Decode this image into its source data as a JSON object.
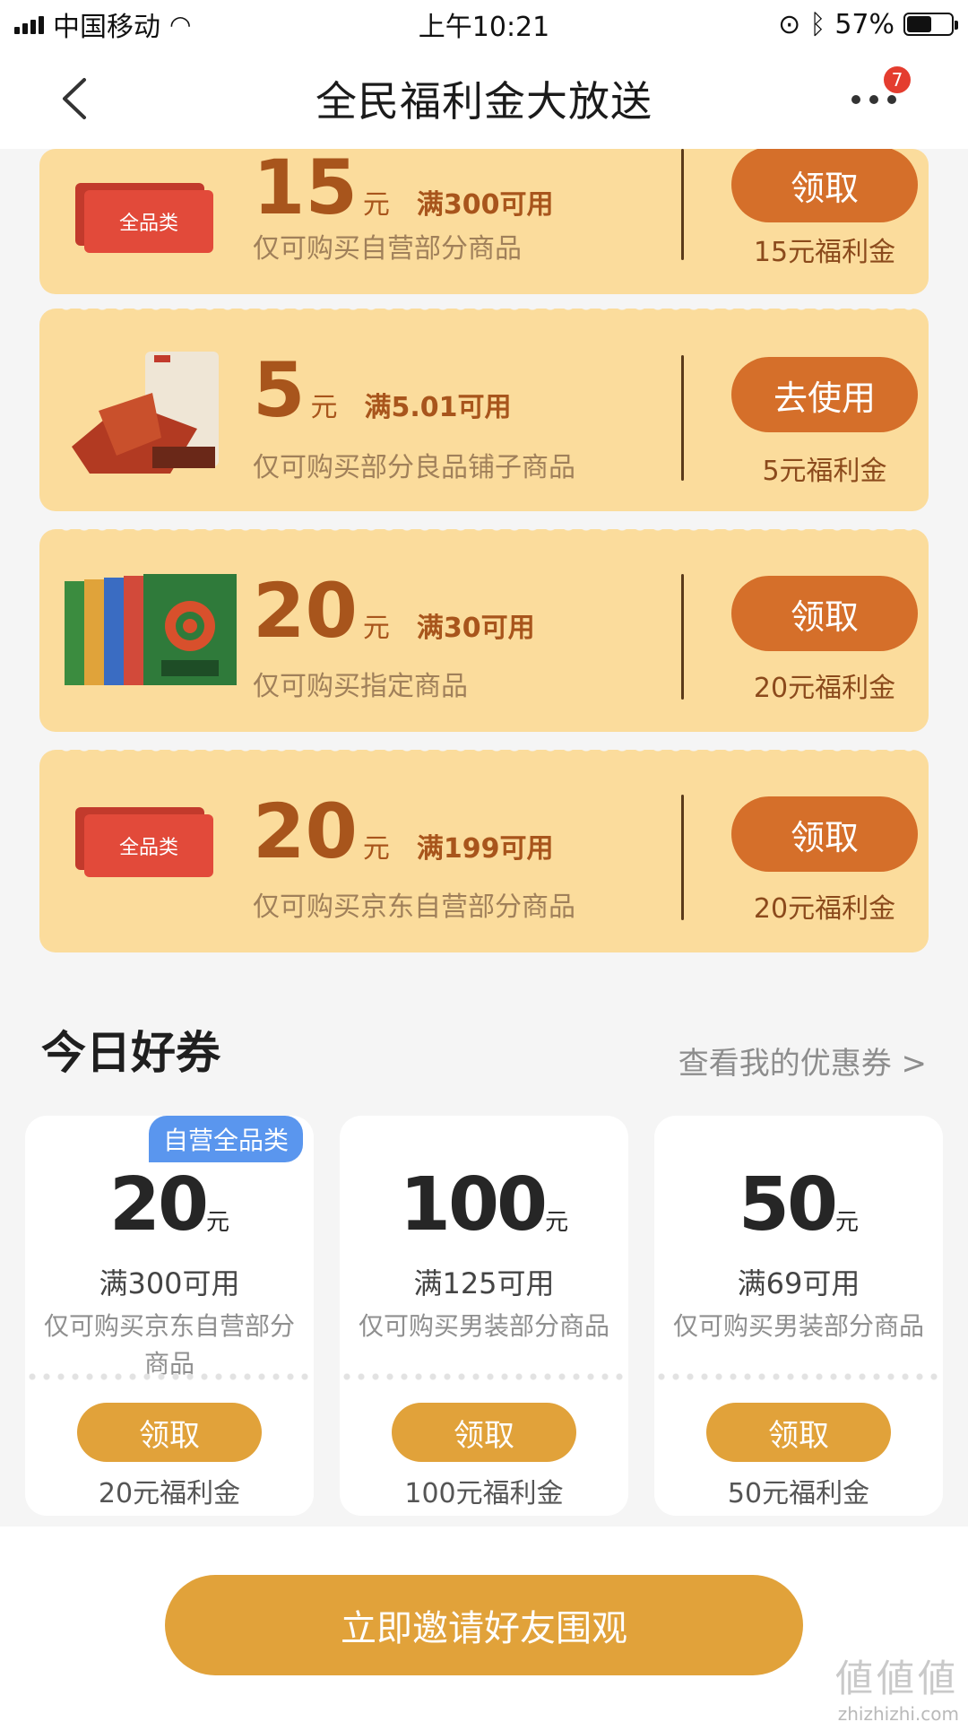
{
  "status_bar": {
    "carrier": "中国移动",
    "time": "上午10:21",
    "battery_percent": "57%",
    "battery_level": 0.57
  },
  "nav": {
    "title": "全民福利金大放送",
    "badge": "7"
  },
  "cards": [
    {
      "amount": "15",
      "unit": "元",
      "condition": "满300可用",
      "description": "仅可购买自营部分商品",
      "button": "领取",
      "reward": "15元福利金",
      "ticket": "全品类"
    },
    {
      "amount": "5",
      "unit": "元",
      "condition": "满5.01可用",
      "description": "仅可购买部分良品铺子商品",
      "button": "去使用",
      "reward": "5元福利金"
    },
    {
      "amount": "20",
      "unit": "元",
      "condition": "满30可用",
      "description": "仅可购买指定商品",
      "button": "领取",
      "reward": "20元福利金"
    },
    {
      "amount": "20",
      "unit": "元",
      "condition": "满199可用",
      "description": "仅可购买京东自营部分商品",
      "button": "领取",
      "reward": "20元福利金",
      "ticket": "全品类"
    }
  ],
  "section": {
    "title": "今日好券",
    "link": "查看我的优惠券 >"
  },
  "small_coupons": [
    {
      "tag": "自营全品类",
      "amount": "20",
      "unit": "元",
      "condition": "满300可用",
      "description": "仅可购买京东自营部分商品",
      "button": "领取",
      "reward": "20元福利金"
    },
    {
      "amount": "100",
      "unit": "元",
      "condition": "满125可用",
      "description": "仅可购买男装部分商品",
      "button": "领取",
      "reward": "100元福利金"
    },
    {
      "amount": "50",
      "unit": "元",
      "condition": "满69可用",
      "description": "仅可购买男装部分商品",
      "button": "领取",
      "reward": "50元福利金"
    }
  ],
  "invite_button": "立即邀请好友围观",
  "watermark": {
    "logo": "値値値",
    "domain": "zhizhizhi.com"
  }
}
